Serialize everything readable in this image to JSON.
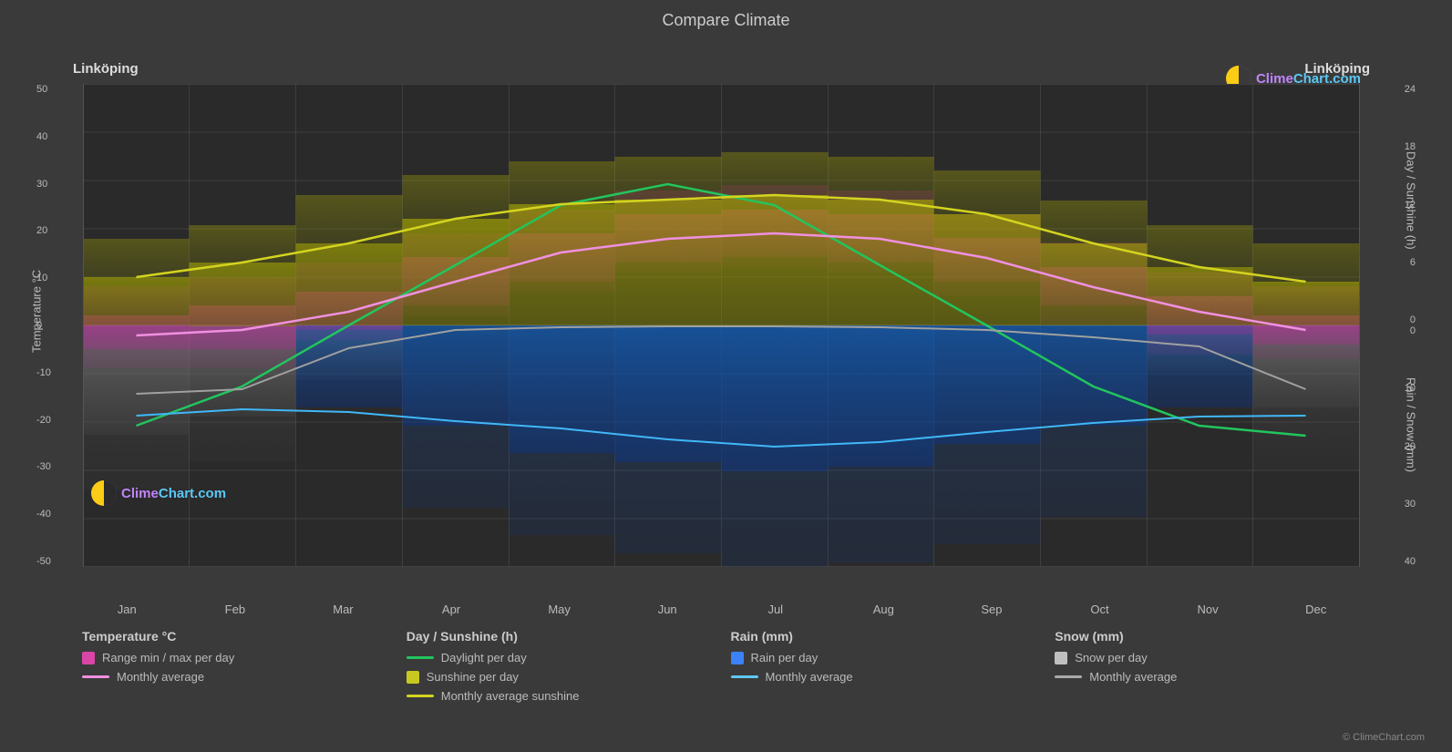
{
  "title": "Compare Climate",
  "city_left": "Linköping",
  "city_right": "Linköping",
  "logo_text": "ClimeChart.com",
  "copyright": "© ClimeChart.com",
  "left_axis_label": "Temperature °C",
  "right_axis_label_top": "Day / Sunshine (h)",
  "right_axis_label_bottom": "Rain / Snow (mm)",
  "months": [
    "Jan",
    "Feb",
    "Mar",
    "Apr",
    "May",
    "Jun",
    "Jul",
    "Aug",
    "Sep",
    "Oct",
    "Nov",
    "Dec"
  ],
  "y_axis_left": [
    "50",
    "40",
    "30",
    "20",
    "10",
    "0",
    "-10",
    "-20",
    "-30",
    "-40",
    "-50"
  ],
  "y_axis_right_top": [
    "24",
    "18",
    "12",
    "6",
    "0"
  ],
  "y_axis_right_bottom": [
    "0",
    "10",
    "20",
    "30",
    "40"
  ],
  "legend": {
    "col1_title": "Temperature °C",
    "col1_items": [
      {
        "type": "rect",
        "color": "#d946a8",
        "label": "Range min / max per day"
      },
      {
        "type": "line",
        "color": "#f0a0e0",
        "label": "Monthly average"
      }
    ],
    "col2_title": "Day / Sunshine (h)",
    "col2_items": [
      {
        "type": "line",
        "color": "#22c55e",
        "label": "Daylight per day"
      },
      {
        "type": "rect",
        "color": "#c8c820",
        "label": "Sunshine per day"
      },
      {
        "type": "line",
        "color": "#d4d420",
        "label": "Monthly average sunshine"
      }
    ],
    "col3_title": "Rain (mm)",
    "col3_items": [
      {
        "type": "rect",
        "color": "#3b82f6",
        "label": "Rain per day"
      },
      {
        "type": "line",
        "color": "#60c8f8",
        "label": "Monthly average"
      }
    ],
    "col4_title": "Snow (mm)",
    "col4_items": [
      {
        "type": "rect",
        "color": "#c0c0c0",
        "label": "Snow per day"
      },
      {
        "type": "line",
        "color": "#aaaaaa",
        "label": "Monthly average"
      }
    ]
  }
}
